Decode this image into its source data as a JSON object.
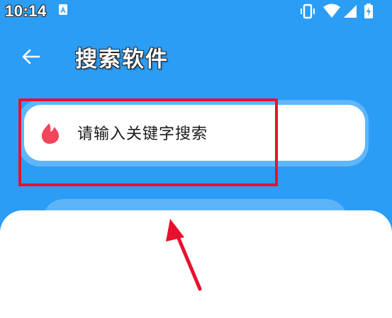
{
  "status_bar": {
    "time": "10:14",
    "app_icon": "accessibility-app-icon",
    "icons": [
      "vibrate-icon",
      "wifi-icon",
      "signal-icon",
      "battery-charging-icon"
    ]
  },
  "header": {
    "back_icon": "arrow-left-icon",
    "title": "搜索软件"
  },
  "search": {
    "logo_icon": "flame-logo-icon",
    "placeholder": "请输入关键字搜索"
  },
  "annotations": {
    "highlight_color": "#e8112d",
    "arrow_color": "#e8112d"
  },
  "colors": {
    "background": "#2c9df5",
    "search_ring": "#60b6fa",
    "sheet": "#ffffff",
    "logo": "#f2465b"
  }
}
